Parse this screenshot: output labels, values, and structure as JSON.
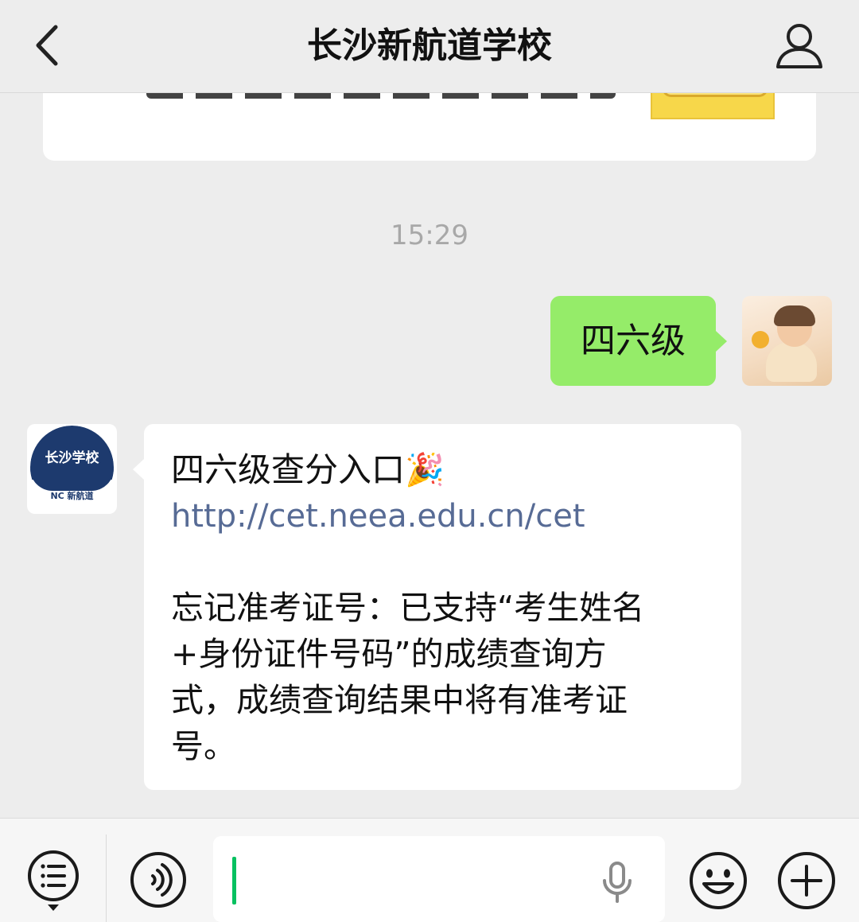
{
  "header": {
    "title": "长沙新航道学校"
  },
  "timestamp": "15:29",
  "outgoing_message": {
    "text": "四六级"
  },
  "incoming_message": {
    "avatar_name": "长沙学校",
    "avatar_subtext": "NC 新航道",
    "line1": "四六级查分入口",
    "line1_emoji": "🎉",
    "link": "http://cet.neea.edu.cn/cet",
    "body": "忘记准考证号：已支持“考生姓名\n+身份证件号码”的成绩查询方\n式，成绩查询结果中将有准考证\n号。"
  },
  "input_bar": {
    "value": ""
  },
  "colors": {
    "background": "#ededed",
    "outgoing_bubble": "#95ec69",
    "link": "#576b95",
    "caret": "#07c160"
  },
  "icons": [
    "back-chevron-icon",
    "profile-icon",
    "menu-list-icon",
    "voice-icon",
    "microphone-icon",
    "emoji-icon",
    "add-icon"
  ]
}
